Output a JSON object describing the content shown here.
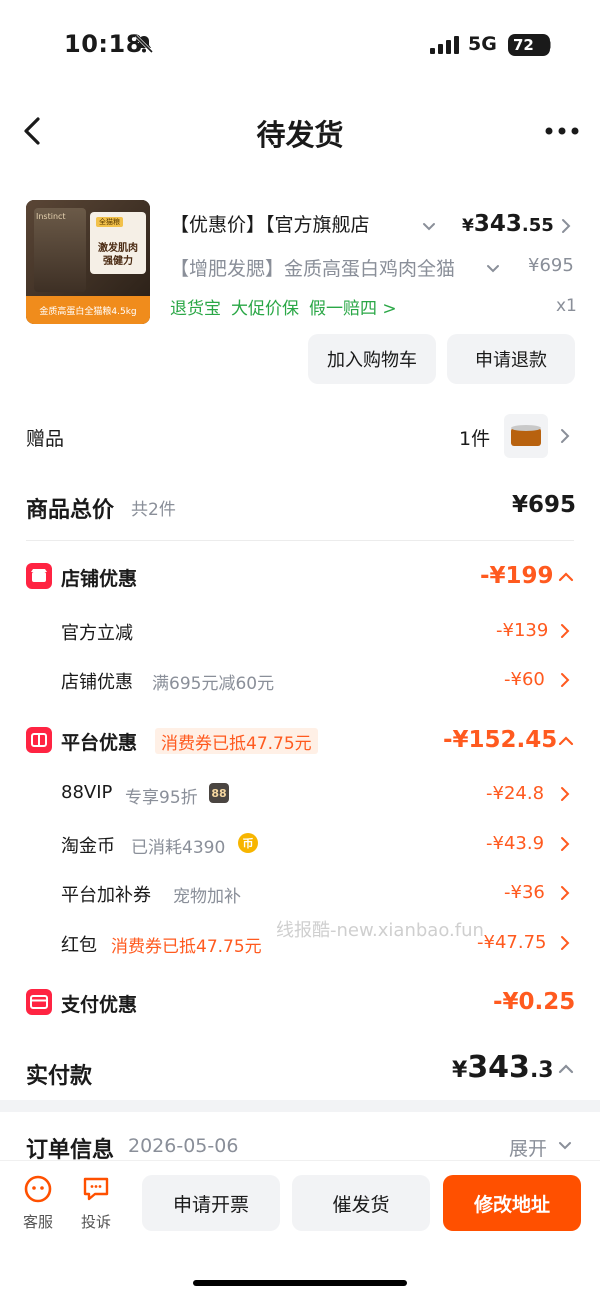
{
  "status": {
    "time": "10:18",
    "network": "5G",
    "battery": "72"
  },
  "nav": {
    "title": "待发货"
  },
  "product": {
    "thumb_brand": "Instinct",
    "thumb_tag": "全猫粮",
    "thumb_line1": "激发肌肉",
    "thumb_line2": "强健力",
    "thumb_bottom": "金质高蛋白全猫粮4.5kg",
    "title": "【优惠价】【官方旗舰店",
    "price_symbol": "¥",
    "price_int": "343",
    "price_dec": ".55",
    "spec": "【增肥发腮】金质高蛋白鸡肉全猫",
    "orig_price": "¥695",
    "tags": [
      "退货宝",
      "大促价保",
      "假一赔四 >"
    ],
    "qty": "x1"
  },
  "actions": {
    "add_cart": "加入购物车",
    "refund": "申请退款"
  },
  "gift": {
    "label": "赠品",
    "count": "1件"
  },
  "total": {
    "label": "商品总价",
    "sub": "共2件",
    "value": "¥695"
  },
  "store_discount": {
    "label": "店铺优惠",
    "value": "-¥199",
    "rows": [
      {
        "label": "官方立减",
        "sub": "",
        "value": "-¥139"
      },
      {
        "label": "店铺优惠",
        "sub": "满695元减60元",
        "value": "-¥60"
      }
    ]
  },
  "platform_discount": {
    "label": "平台优惠",
    "pill": "消费券已抵47.75元",
    "value": "-¥152.45",
    "rows": [
      {
        "label": "88VIP",
        "sub": "专享95折",
        "badge": "88",
        "value": "-¥24.8"
      },
      {
        "label": "淘金币",
        "sub": "已消耗4390",
        "badge": "币",
        "value": "-¥43.9"
      },
      {
        "label": "平台加补券",
        "sub": "宠物加补",
        "value": "-¥36"
      },
      {
        "label": "红包",
        "sub": "消费券已抵47.75元",
        "value": "-¥47.75"
      }
    ]
  },
  "watermark": "线报酷-new.xianbao.fun",
  "pay_discount": {
    "label": "支付优惠",
    "value": "-¥0.25"
  },
  "paid": {
    "label": "实付款",
    "symbol": "¥",
    "int": "343",
    "dec": ".3"
  },
  "order": {
    "label": "订单信息",
    "date": "2026-05-06",
    "expand": "展开"
  },
  "bottom": {
    "service": "客服",
    "complain": "投诉",
    "invoice": "申请开票",
    "urge": "催发货",
    "modify": "修改地址"
  },
  "colors": {
    "accent": "#ff5000",
    "discount": "#ff5a1f",
    "green": "#2aa746",
    "badge_red": "#ff2442"
  }
}
